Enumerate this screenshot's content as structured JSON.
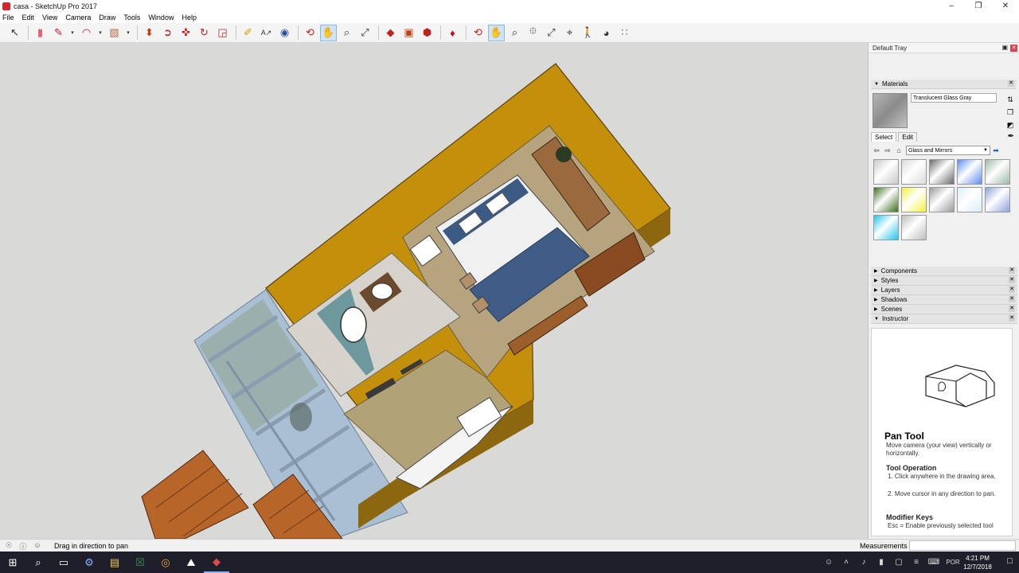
{
  "window": {
    "title": "casa - SketchUp Pro 2017",
    "controls": [
      "–",
      "❒",
      "✕"
    ]
  },
  "menu": [
    "File",
    "Edit",
    "View",
    "Camera",
    "Draw",
    "Tools",
    "Window",
    "Help"
  ],
  "toolbar": {
    "groups": [
      [
        "select",
        "eraser",
        "pencil",
        "arc",
        "rectangle"
      ],
      [
        "push-pull",
        "follow-me",
        "move",
        "rotate",
        "scale"
      ],
      [
        "tape",
        "text",
        "paint"
      ],
      [
        "orbit",
        "pan",
        "zoom",
        "zoom-extents"
      ],
      [
        "section",
        "component",
        "warehouse"
      ],
      [
        "ruby"
      ],
      [
        "orbit2",
        "pan2",
        "zoom2",
        "zoom-window",
        "zoom-extents2",
        "prev-view",
        "walk",
        "look-around",
        "footprints"
      ]
    ],
    "active": [
      "pan",
      "pan2"
    ]
  },
  "tray": {
    "title": "Default Tray",
    "materials": {
      "header": "Materials",
      "current_name": "Translucent Glass Gray",
      "tabs": [
        "Select",
        "Edit"
      ],
      "library": "Glass and Mirrors",
      "swatch_colors": [
        "#c8c8c8",
        "#dadada",
        "#6b6b6b",
        "#5b8ef0",
        "#9fb8a8",
        "#3f6e22",
        "#f2f23a",
        "#9a9a9a",
        "#d8eef8",
        "#8ea2d8",
        "#22c4ec",
        "#bdbdbd"
      ]
    },
    "panels": [
      "Components",
      "Styles",
      "Layers",
      "Shadows",
      "Scenes",
      "Instructor"
    ],
    "instructor": {
      "title": "Pan Tool",
      "description": "Move camera (your view) vertically or horizontally.",
      "operation_heading": "Tool Operation",
      "steps": [
        "1.  Click anywhere in the drawing area.",
        "2.  Move cursor in any direction to pan."
      ],
      "modifier_heading": "Modifier Keys",
      "modifier_text": "Esc = Enable previously selected tool"
    }
  },
  "status": {
    "message": "Drag in direction to pan",
    "measurements_label": "Measurements"
  },
  "taskbar": {
    "language": "POR",
    "time": "4:21 PM",
    "date": "12/7/2018"
  }
}
